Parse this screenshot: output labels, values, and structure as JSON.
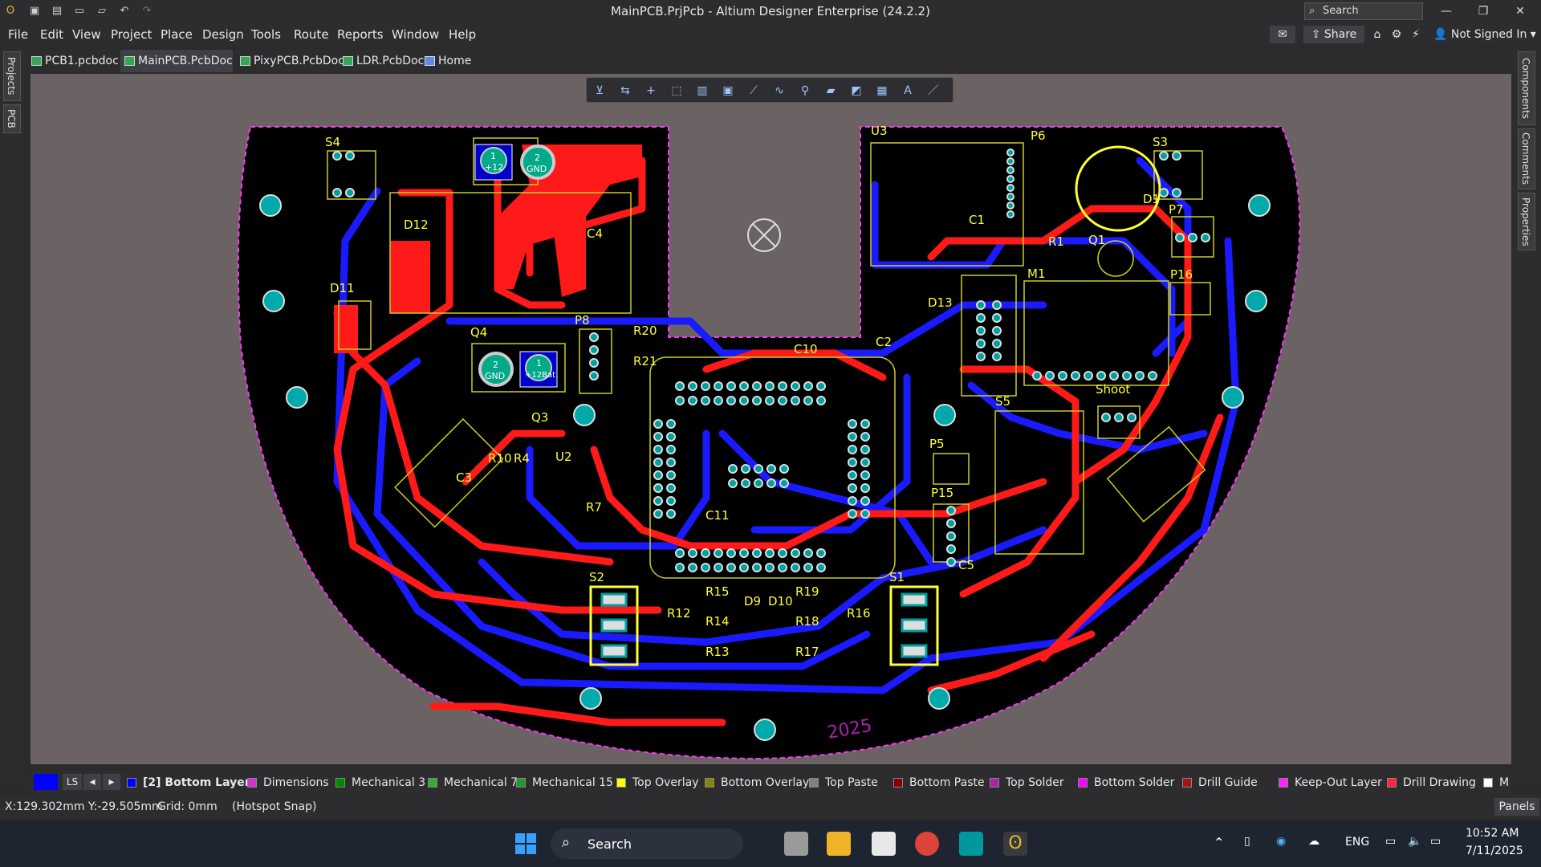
{
  "window": {
    "title": "MainPCB.PrjPcb - Altium Designer Enterprise (24.2.2)",
    "search_placeholder": "Search",
    "user": "Not Signed In",
    "share_label": "Share"
  },
  "menu": [
    "File",
    "Edit",
    "View",
    "Project",
    "Place",
    "Design",
    "Tools",
    "Route",
    "Reports",
    "Window",
    "Help"
  ],
  "tabs": [
    {
      "label": "PCB1.pcbdoc",
      "active": false
    },
    {
      "label": "MainPCB.PcbDoc *",
      "active": true
    },
    {
      "label": "PixyPCB.PcbDoc",
      "active": false
    },
    {
      "label": "LDR.PcbDoc",
      "active": false
    },
    {
      "label": "Home Page",
      "active": false
    }
  ],
  "left_panels": [
    "Projects",
    "PCB"
  ],
  "right_panels": [
    "Components",
    "Comments",
    "Properties"
  ],
  "pcb_toolbar_icons": [
    "filter-icon",
    "route-icon",
    "place-cross-icon",
    "select-rect-icon",
    "align-icon",
    "place-fill-icon",
    "interactive-route-icon",
    "diff-pair-icon",
    "place-via-icon",
    "place-polygon-icon",
    "place-pad-icon",
    "component-icon",
    "place-string-icon",
    "place-line-icon"
  ],
  "pcb": {
    "labels": {
      "s4": "S4",
      "s3": "S3",
      "s2": "S2",
      "s1": "S1",
      "s5": "S5",
      "u3": "U3",
      "u2": "U2",
      "p6": "P6",
      "p7": "P7",
      "p8": "P8",
      "p5": "P5",
      "p15": "P15",
      "p16": "P16",
      "c1": "C1",
      "c2": "C2",
      "c3": "C3",
      "c4": "C4",
      "c5": "C5",
      "c10": "C10",
      "c11": "C11",
      "r1": "R1",
      "r4": "R4",
      "r7": "R7",
      "r10": "R10",
      "r12": "R12",
      "r13": "R13",
      "r14": "R14",
      "r15": "R15",
      "r16": "R16",
      "r17": "R17",
      "r18": "R18",
      "r19": "R19",
      "r20": "R20",
      "r21": "R21",
      "d1": "D1",
      "d9": "D9",
      "d10": "D10",
      "d11": "D11",
      "d12": "D12",
      "d13": "D13",
      "q1": "Q1",
      "q3": "Q3",
      "q4": "Q4",
      "m1": "M1",
      "shoot": "Shoot",
      "year": "2025",
      "gnd": "GND",
      "plus12": "+12",
      "plus12bat": "+12Bat",
      "one": "1",
      "two": "2"
    }
  },
  "layers": {
    "current": "LS",
    "items": [
      {
        "label": "[2] Bottom Layer",
        "color": "#0000ff",
        "bold": true
      },
      {
        "label": "Dimensions",
        "color": "#cc33cc"
      },
      {
        "label": "Mechanical 3",
        "color": "#008800"
      },
      {
        "label": "Mechanical 7",
        "color": "#33aa33"
      },
      {
        "label": "Mechanical 15",
        "color": "#229922"
      },
      {
        "label": "Top Overlay",
        "color": "#ffff00"
      },
      {
        "label": "Bottom Overlay",
        "color": "#888800"
      },
      {
        "label": "Top Paste",
        "color": "#808080"
      },
      {
        "label": "Bottom Paste",
        "color": "#880000"
      },
      {
        "label": "Top Solder",
        "color": "#aa22aa"
      },
      {
        "label": "Bottom Solder",
        "color": "#ff00ff"
      },
      {
        "label": "Drill Guide",
        "color": "#aa1111"
      },
      {
        "label": "Keep-Out Layer",
        "color": "#ff22ff"
      },
      {
        "label": "Drill Drawing",
        "color": "#ff2244"
      },
      {
        "label": "M",
        "color": "#ffffff"
      }
    ]
  },
  "status": {
    "coords": "X:129.302mm Y:-29.505mm",
    "grid": "Grid: 0mm",
    "snap": "(Hotspot Snap)",
    "panels": "Panels"
  },
  "taskbar": {
    "search": "Search",
    "lang": "ENG",
    "time": "10:52 AM",
    "date": "7/11/2025"
  }
}
